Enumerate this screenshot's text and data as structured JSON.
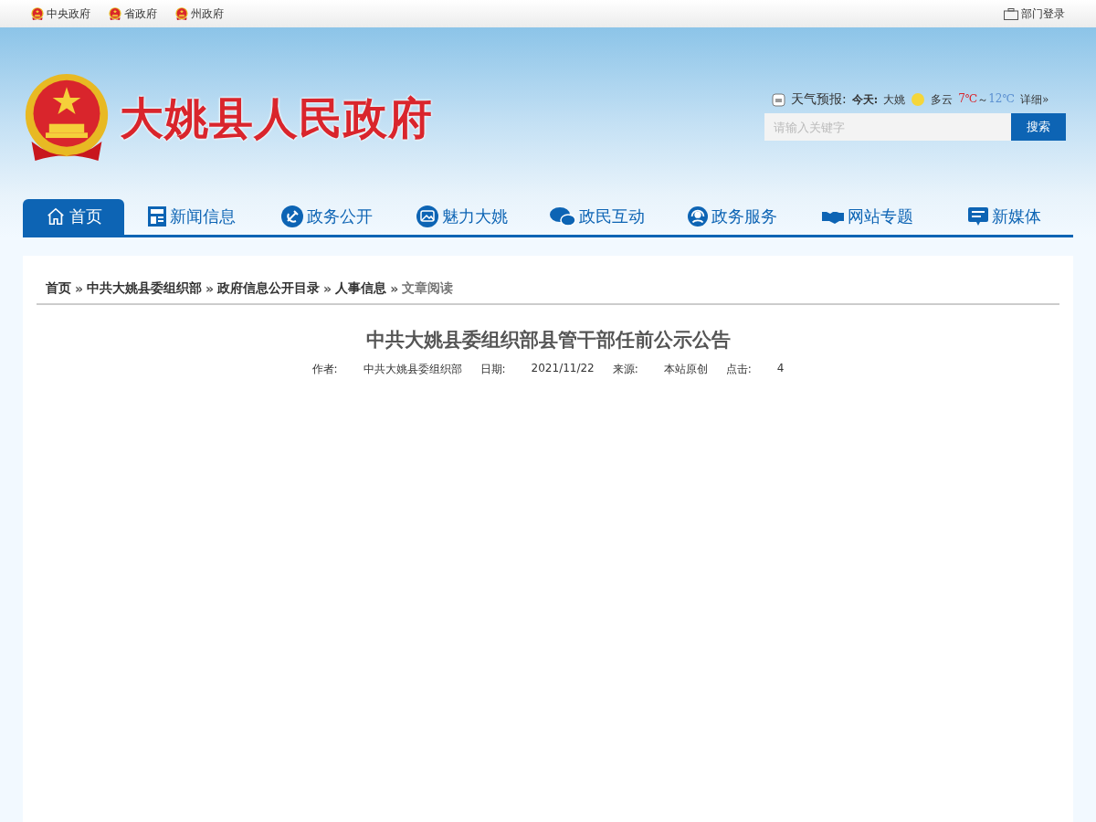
{
  "top_links": [
    {
      "label": "中央政府"
    },
    {
      "label": "省政府"
    },
    {
      "label": "州政府"
    }
  ],
  "login": {
    "label": "部门登录"
  },
  "site_title": "大姚县人民政府",
  "weather": {
    "label": "天气预报:",
    "day": "今天:",
    "place": "大姚",
    "condition": "多云",
    "low": "7℃",
    "tilde": "～",
    "high": "12℃",
    "more": "详细»"
  },
  "search": {
    "placeholder": "请输入关键字",
    "button": "搜索"
  },
  "nav": [
    {
      "label": "首页",
      "selected": true
    },
    {
      "label": "新闻信息",
      "selected": false
    },
    {
      "label": "政务公开",
      "selected": false
    },
    {
      "label": "魅力大姚",
      "selected": false
    },
    {
      "label": "政民互动",
      "selected": false
    },
    {
      "label": "政务服务",
      "selected": false
    },
    {
      "label": "网站专题",
      "selected": false
    },
    {
      "label": "新媒体",
      "selected": false
    }
  ],
  "breadcrumb": [
    {
      "label": "首页",
      "current": false
    },
    {
      "sep": "»",
      "label": "中共大姚县委组织部",
      "current": false
    },
    {
      "sep": "»",
      "label": "政府信息公开目录",
      "current": false
    },
    {
      "sep": "»",
      "label": "人事信息",
      "current": false
    },
    {
      "sep": "»",
      "label": "文章阅读",
      "current": true
    }
  ],
  "article": {
    "title": "中共大姚县委组织部县管干部任前公示公告",
    "meta": [
      {
        "label": "作者:",
        "value": "中共大姚县委组织部"
      },
      {
        "label": "日期:",
        "value": "2021/11/22"
      },
      {
        "label": "来源:",
        "value": "本站原创"
      },
      {
        "label": "点击:",
        "value": "4"
      }
    ]
  }
}
